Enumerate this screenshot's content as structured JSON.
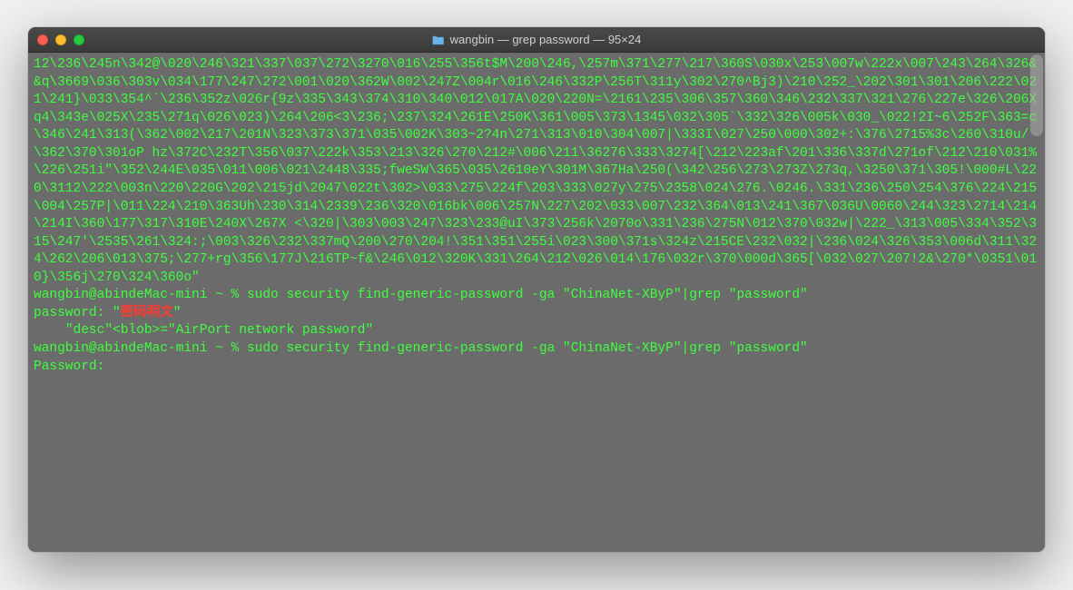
{
  "window": {
    "title": "wangbin — grep password — 95×24"
  },
  "terminal": {
    "binary_output": "12\\236\\245n\\342@\\020\\246\\321\\337\\037\\272\\3270\\016\\255\\356t$M\\200\\246,\\257m\\371\\277\\217\\360S\\030x\\253\\007w\\222x\\007\\243\\264\\326&&q\\3669\\036\\303v\\034\\177\\247\\272\\001\\020\\362W\\002\\247Z\\004r\\016\\246\\332P\\256T\\311y\\302\\270^Bj3)\\210\\252_\\202\\301\\301\\206\\222\\021\\241}\\033\\354^`\\236\\352z\\026r{9z\\335\\343\\374\\310\\340\\012\\017A\\020\\220N=\\2161\\235\\306\\357\\360\\346\\232\\337\\321\\276\\227e\\326\\206Xq4\\343e\\025X\\235\\271q\\026\\023)\\264\\206<3\\236;\\237\\324\\261E\\250K\\361\\005\\373\\1345\\032\\305`\\332\\326\\005k\\030_\\022!2I~6\\252F\\363=c\\346\\241\\313(\\362\\002\\217\\201N\\323\\373\\371\\035\\002K\\303~2?4n\\271\\313\\010\\304\\007|\\333I\\027\\250\\000\\302+:\\376\\2715%3c\\260\\310u/\\362\\370\\301oP hz\\372C\\232T\\356\\037\\222k\\353\\213\\326\\270\\212#\\006\\211\\36276\\333\\3274[\\212\\223af\\201\\336\\337d\\271of\\212\\210\\031%\\226\\251i\"\\352\\244E\\035\\011\\006\\021\\2448\\335;fweSW\\365\\035\\2610eY\\301M\\367Ha\\250(\\342\\256\\273\\273Z\\273q,\\3250\\371\\305!\\000#L\\220\\3112\\222\\003n\\220\\220G\\202\\215jd\\2047\\022t\\302>\\033\\275\\224f\\203\\333\\027y\\275\\2358\\024\\276.\\0246.\\331\\236\\250\\254\\376\\224\\215\\004\\257P|\\011\\224\\210\\363Uh\\230\\314\\2339\\236\\320\\016bk\\006\\257N\\227\\202\\033\\007\\232\\364\\013\\241\\367\\036U\\0060\\244\\323\\2714\\214\\214I\\360\\177\\317\\310E\\240X\\267X <\\320|\\303\\003\\247\\323\\233@uI\\373\\256k\\2070o\\331\\236\\275N\\012\\370\\032w|\\222_\\313\\005\\334\\352\\315\\247'\\2535\\261\\324:;\\003\\326\\232\\337mQ\\200\\270\\204!\\351\\351\\255i\\023\\300\\371s\\324z\\215CE\\232\\032|\\236\\024\\326\\353\\006d\\311\\324\\262\\206\\013\\375;\\277+rg\\356\\177J\\216TP~f&\\246\\012\\320K\\331\\264\\212\\026\\014\\176\\032r\\370\\000d\\365[\\032\\027\\207!2&\\270*\\0351\\010}\\356j\\270\\324\\360o\"",
    "prompt1_user": "wangbin@abindeMac-mini ~ % ",
    "prompt1_cmd": "sudo security find-generic-password -ga \"ChinaNet-XByP\"|grep \"password\"",
    "password_label": "password: \"",
    "password_value": "密码明文",
    "password_quote_close": "\"",
    "desc_line": "    \"desc\"<blob>=\"AirPort network password\"",
    "prompt2_user": "wangbin@abindeMac-mini ~ % ",
    "prompt2_cmd": "sudo security find-generic-password -ga \"ChinaNet-XByP\"|grep \"password\"",
    "sudo_prompt": "Password:"
  }
}
